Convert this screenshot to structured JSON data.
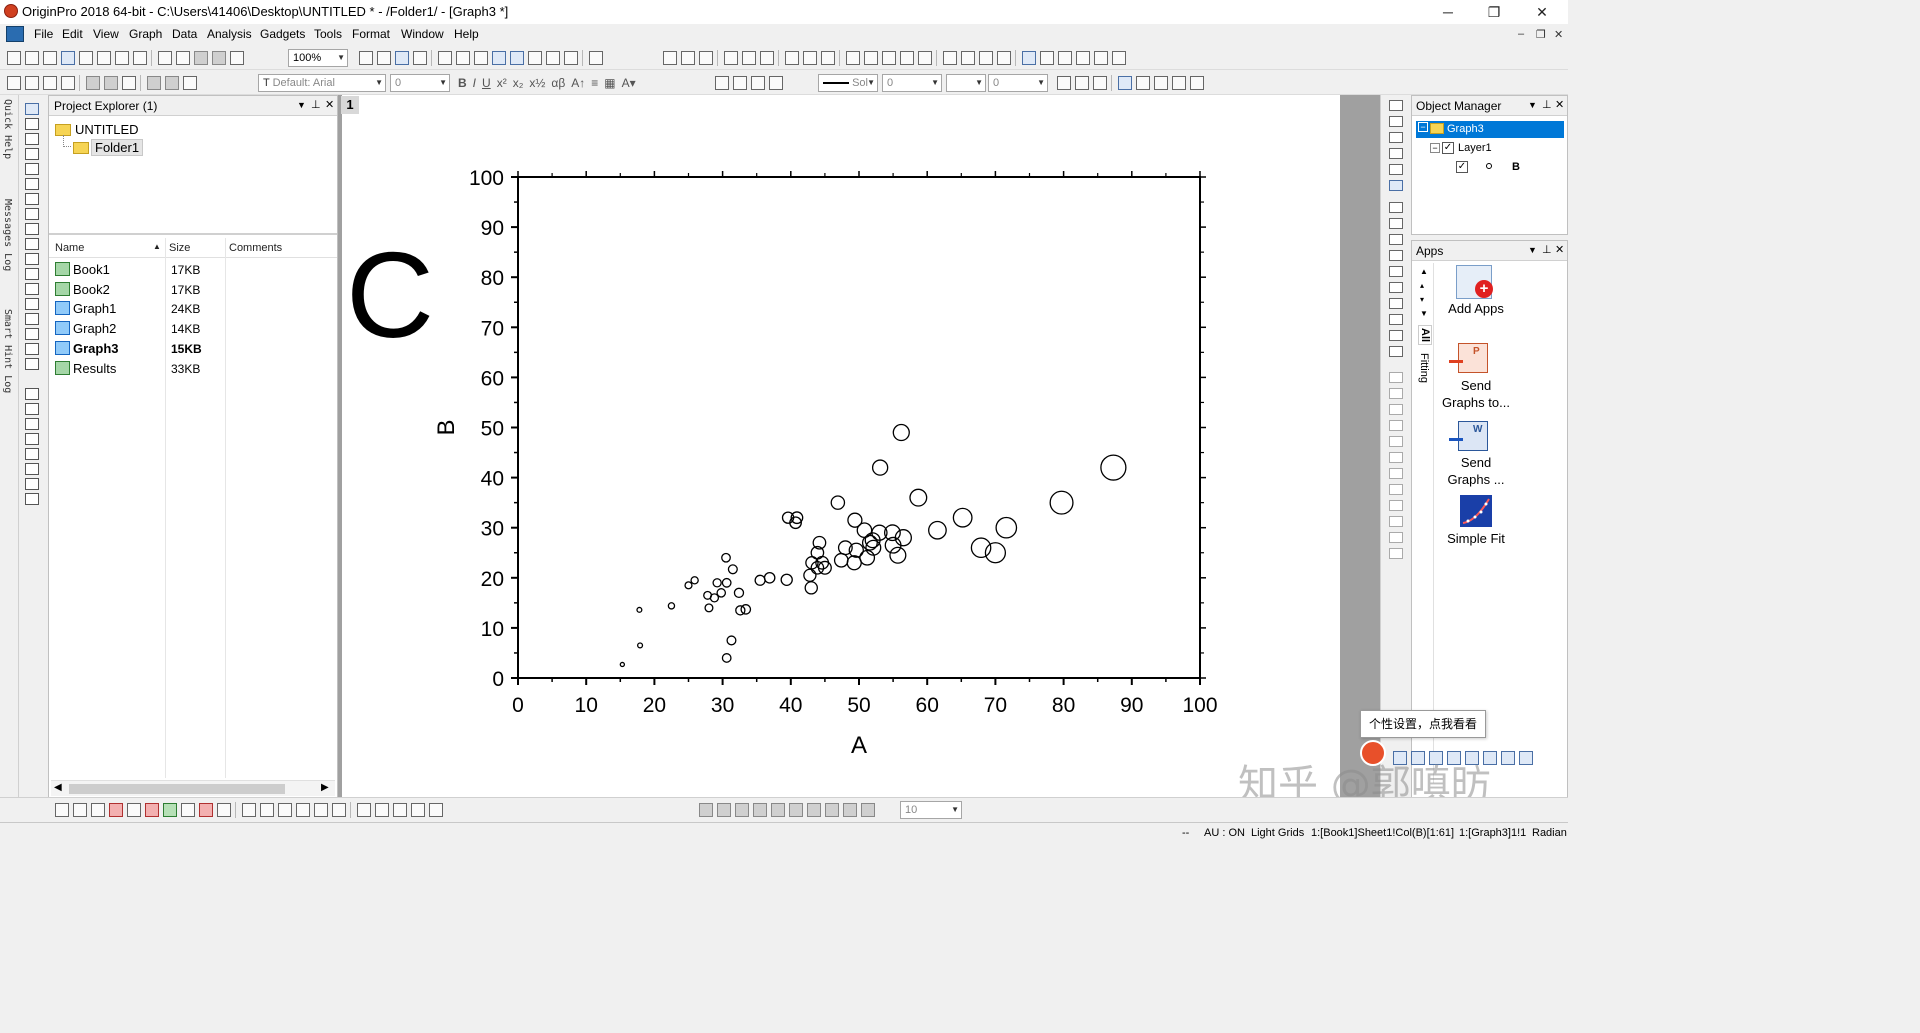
{
  "window": {
    "title": "OriginPro 2018 64-bit - C:\\Users\\41406\\Desktop\\UNTITLED * - /Folder1/ - [Graph3 *]",
    "min": "─",
    "max": "❐",
    "close": "✕"
  },
  "menu": [
    "File",
    "Edit",
    "View",
    "Graph",
    "Data",
    "Analysis",
    "Gadgets",
    "Tools",
    "Format",
    "Window",
    "Help"
  ],
  "mdi_controls": {
    "min": "‒",
    "restore": "❐",
    "close": "✕"
  },
  "toolbar": {
    "zoom": "100%",
    "font": "Default: Arial",
    "font_size": "0",
    "line_style": "Sol",
    "line_width": "0",
    "pattern_size": "0",
    "bottom_zoom": "10"
  },
  "left_tabs": [
    "Quick Help",
    "Messages Log",
    "Smart Hint Log"
  ],
  "project_explorer": {
    "title": "Project Explorer (1)",
    "root": "UNTITLED",
    "folder": "Folder1",
    "columns": {
      "name": "Name",
      "size": "Size",
      "comments": "Comments"
    },
    "files": [
      {
        "name": "Book1",
        "size": "17KB",
        "type": "book",
        "bold": false
      },
      {
        "name": "Book2",
        "size": "17KB",
        "type": "book",
        "bold": false
      },
      {
        "name": "Graph1",
        "size": "24KB",
        "type": "graph",
        "bold": false
      },
      {
        "name": "Graph2",
        "size": "14KB",
        "type": "graph",
        "bold": false
      },
      {
        "name": "Graph3",
        "size": "15KB",
        "type": "graph",
        "bold": true
      },
      {
        "name": "Results",
        "size": "33KB",
        "type": "book",
        "bold": false
      }
    ]
  },
  "graph_page": {
    "layer_number": "1",
    "panel_label": "C"
  },
  "chart_data": {
    "type": "scatter",
    "title": "",
    "xlabel": "A",
    "ylabel": "B",
    "xlim": [
      0,
      100
    ],
    "ylim": [
      0,
      100
    ],
    "xticks": [
      0,
      10,
      20,
      30,
      40,
      50,
      60,
      70,
      80,
      90,
      100
    ],
    "yticks": [
      0,
      10,
      20,
      30,
      40,
      50,
      60,
      70,
      80,
      90,
      100
    ],
    "grid": false,
    "marker": "open circle, size scales with A",
    "points": [
      [
        15.3,
        2.7
      ],
      [
        17.9,
        6.5
      ],
      [
        17.8,
        13.6
      ],
      [
        22.5,
        14.4
      ],
      [
        25.0,
        18.5
      ],
      [
        25.9,
        19.5
      ],
      [
        27.8,
        16.5
      ],
      [
        28.0,
        14.0
      ],
      [
        28.8,
        16.0
      ],
      [
        29.2,
        19.0
      ],
      [
        29.8,
        17.0
      ],
      [
        30.5,
        24.0
      ],
      [
        30.6,
        19.0
      ],
      [
        30.6,
        4.0
      ],
      [
        31.3,
        7.5
      ],
      [
        31.5,
        21.7
      ],
      [
        32.4,
        17.0
      ],
      [
        32.6,
        13.5
      ],
      [
        33.4,
        13.7
      ],
      [
        35.5,
        19.5
      ],
      [
        36.9,
        20.0
      ],
      [
        39.4,
        19.6
      ],
      [
        39.6,
        32.0
      ],
      [
        40.7,
        31.0
      ],
      [
        40.9,
        32.0
      ],
      [
        42.8,
        20.5
      ],
      [
        43.1,
        23.0
      ],
      [
        43.0,
        18.0
      ],
      [
        43.9,
        25.0
      ],
      [
        43.9,
        22.0
      ],
      [
        44.2,
        27.0
      ],
      [
        44.6,
        23.0
      ],
      [
        45.0,
        22.0
      ],
      [
        46.9,
        35.0
      ],
      [
        47.4,
        23.5
      ],
      [
        48.0,
        26.0
      ],
      [
        49.4,
        31.5
      ],
      [
        49.3,
        23.0
      ],
      [
        49.6,
        25.5
      ],
      [
        50.8,
        29.5
      ],
      [
        51.2,
        24.0
      ],
      [
        51.6,
        27.0
      ],
      [
        52.0,
        27.5
      ],
      [
        52.1,
        26.0
      ],
      [
        53.0,
        29.0
      ],
      [
        53.1,
        42.0
      ],
      [
        54.9,
        29.0
      ],
      [
        55.0,
        26.5
      ],
      [
        55.7,
        24.5
      ],
      [
        56.2,
        49.0
      ],
      [
        56.5,
        28.0
      ],
      [
        58.7,
        36.0
      ],
      [
        61.5,
        29.5
      ],
      [
        65.2,
        32.0
      ],
      [
        67.9,
        26.0
      ],
      [
        70.0,
        25.0
      ],
      [
        71.6,
        30.0
      ],
      [
        79.7,
        35.0
      ],
      [
        87.3,
        42.0
      ]
    ]
  },
  "object_manager": {
    "title": "Object Manager",
    "graph": "Graph3",
    "layer": "Layer1",
    "plot": "B"
  },
  "apps": {
    "title": "Apps",
    "side_tabs": [
      "All",
      "Fitting"
    ],
    "items": [
      {
        "label_lines": [
          "Add Apps"
        ],
        "icon": "add-apps-icon"
      },
      {
        "label_lines": [
          "Send",
          "Graphs to..."
        ],
        "icon": "powerpoint-icon"
      },
      {
        "label_lines": [
          "Send",
          "Graphs ..."
        ],
        "icon": "word-icon"
      },
      {
        "label_lines": [
          "Simple Fit"
        ],
        "icon": "simple-fit-icon"
      }
    ]
  },
  "tooltip": "个性设置，点我看看",
  "watermark": "知乎 @郭嗔昉",
  "status": {
    "dashes": "--",
    "au": "AU : ON",
    "grids": "Light Grids",
    "book_ref": "1:[Book1]Sheet1!Col(B)[1:61]",
    "graph_ref": "1:[Graph3]1!1",
    "angle": "Radian"
  }
}
